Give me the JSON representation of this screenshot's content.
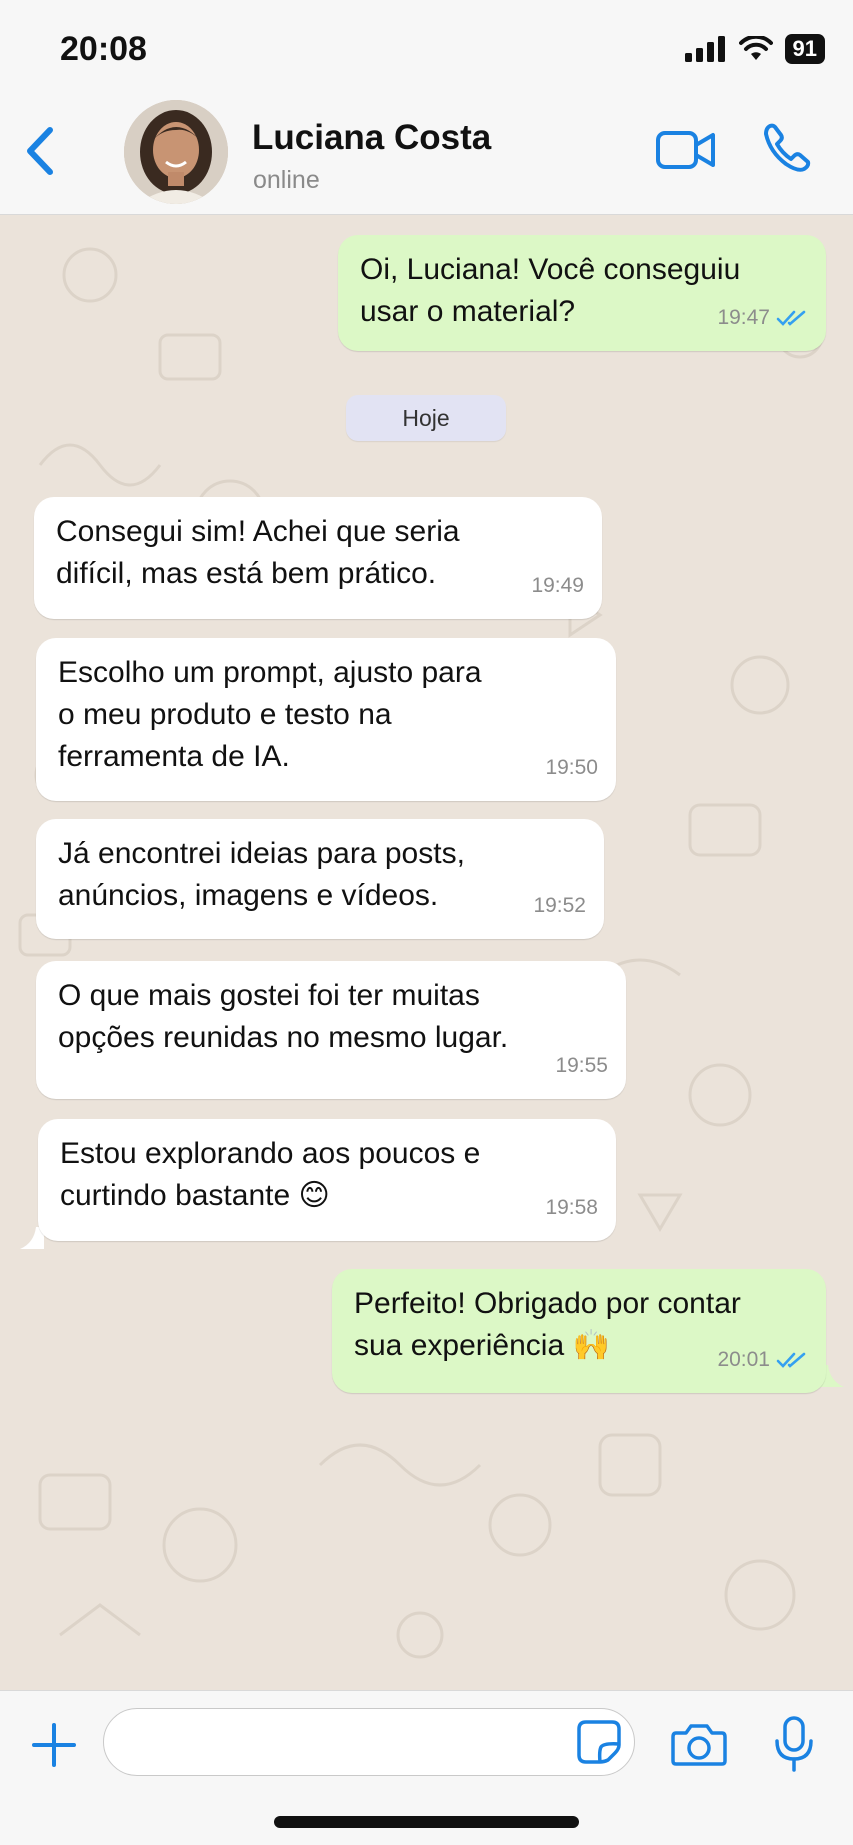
{
  "status_bar": {
    "time": "20:08",
    "battery": "91"
  },
  "header": {
    "contact_name": "Luciana Costa",
    "status": "online"
  },
  "date_separator": "Hoje",
  "messages": [
    {
      "text": "Oi, Luciana! Você conseguiu\nusar o material?",
      "time": "19:47",
      "direction": "out",
      "read": true
    },
    {
      "text": "Consegui sim! Achei que seria\ndifícil, mas está bem prático.",
      "time": "19:49",
      "direction": "in"
    },
    {
      "text": "Escolho um prompt, ajusto para\no meu produto e testo na\nferramenta de IA.",
      "time": "19:50",
      "direction": "in"
    },
    {
      "text": "Já encontrei ideias para posts,\nanúncios, imagens e vídeos.",
      "time": "19:52",
      "direction": "in"
    },
    {
      "text": "O que mais gostei foi ter muitas\nopções reunidas no mesmo lugar.",
      "time": "19:55",
      "direction": "in"
    },
    {
      "text": "Estou explorando aos poucos e\ncurtindo bastante 😊",
      "time": "19:58",
      "direction": "in"
    },
    {
      "text": "Perfeito! Obrigado por contar\nsua experiência 🙌",
      "time": "20:01",
      "direction": "out",
      "read": true
    }
  ],
  "composer": {
    "value": "",
    "placeholder": ""
  },
  "colors": {
    "accent": "#1a82e2",
    "outgoing_bubble": "#dcf8c6",
    "incoming_bubble": "#ffffff",
    "read_ticks": "#34a0f0",
    "chat_background": "#ebe3da"
  }
}
